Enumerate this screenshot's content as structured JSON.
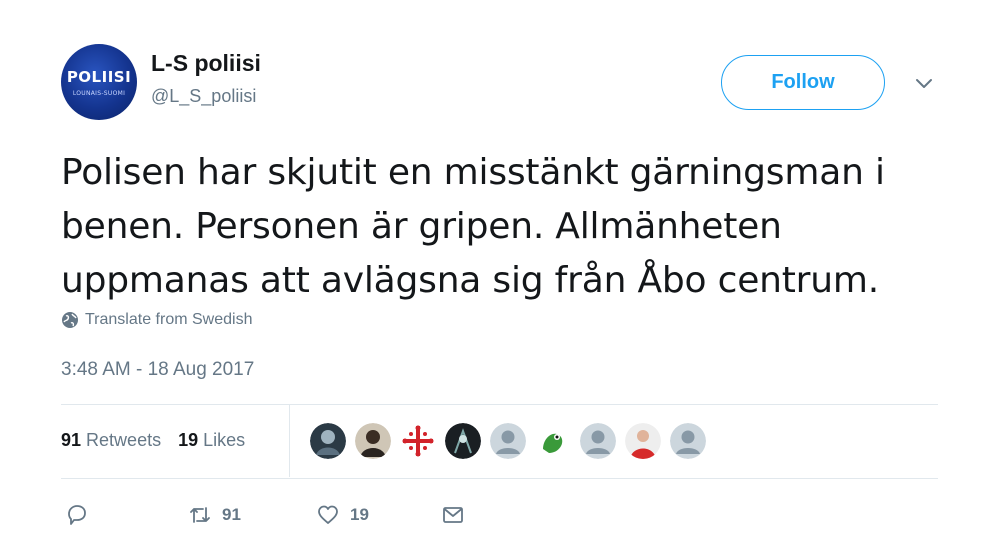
{
  "account": {
    "display_name": "L-S poliisi",
    "handle": "@L_S_poliisi",
    "avatar_text": "POLIISI",
    "avatar_subtext": "LOUNAIS-SUOMI"
  },
  "follow_label": "Follow",
  "tweet": {
    "text": "Polisen har skjutit en misstänkt gärningsman i benen. Personen är gripen. Allmänheten uppmanas att avlägsna sig från Åbo centrum.",
    "translate_label": "Translate from Swedish",
    "timestamp": "3:48 AM - 18 Aug 2017"
  },
  "stats": {
    "retweets_count": "91",
    "retweets_label": "Retweets",
    "likes_count": "19",
    "likes_label": "Likes"
  },
  "actions": {
    "retweet_count": "91",
    "like_count": "19"
  },
  "colors": {
    "accent": "#1da1f2",
    "secondary_text": "#657786",
    "divider": "#e1e8ed"
  },
  "icons": [
    "chevron-down-icon",
    "globe-icon",
    "reply-icon",
    "retweet-icon",
    "heart-icon",
    "message-icon"
  ]
}
